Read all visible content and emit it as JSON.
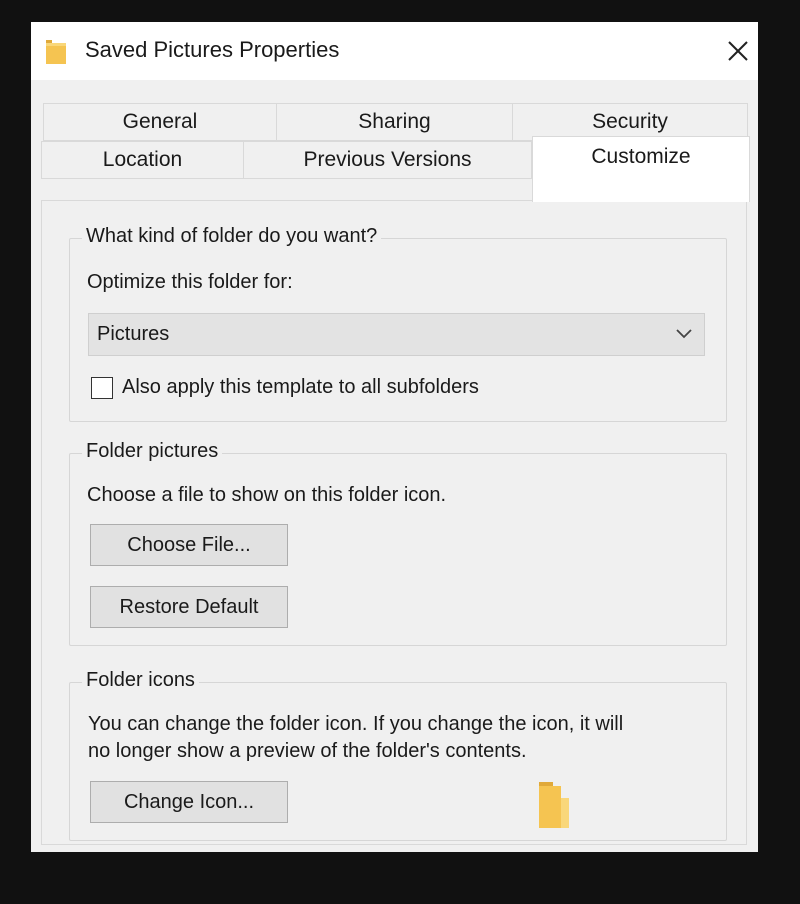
{
  "window": {
    "title": "Saved Pictures Properties",
    "icon": "folder-icon",
    "close_icon": "close-icon"
  },
  "tabs": {
    "row1": [
      {
        "label": "General"
      },
      {
        "label": "Sharing"
      },
      {
        "label": "Security"
      }
    ],
    "row2": [
      {
        "label": "Location"
      },
      {
        "label": "Previous Versions"
      },
      {
        "label": "Customize",
        "active": true
      }
    ]
  },
  "folder_type": {
    "group_label": "What kind of folder do you want?",
    "optimize_label": "Optimize this folder for:",
    "selected_option": "Pictures",
    "subfolders_checkbox_label": "Also apply this template to all subfolders",
    "subfolders_checked": false
  },
  "folder_pictures": {
    "group_label": "Folder pictures",
    "description": "Choose a file to show on this folder icon.",
    "choose_file_label": "Choose File...",
    "restore_default_label": "Restore Default"
  },
  "folder_icons": {
    "group_label": "Folder icons",
    "description_line1": "You can change the folder icon. If you change the icon, it will",
    "description_line2": "no longer show a preview of the folder's contents.",
    "change_icon_label": "Change Icon...",
    "preview_icon": "folder-icon"
  },
  "colors": {
    "folder_yellow": "#f5c451",
    "dialog_bg": "#f0f0f0",
    "backdrop": "#111111"
  }
}
